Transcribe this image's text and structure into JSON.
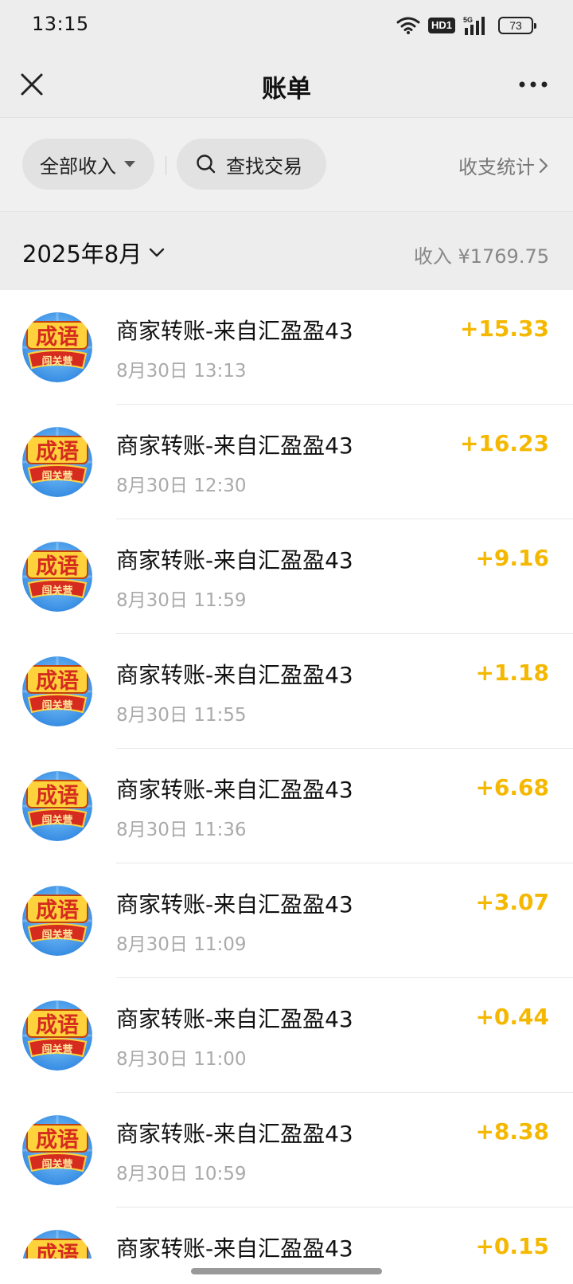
{
  "status_bar": {
    "time": "13:15",
    "hd_label": "HD1",
    "network_label": "5G",
    "battery": "73"
  },
  "nav": {
    "title": "账单",
    "close_icon": "close-icon",
    "more_icon": "more-icon"
  },
  "filters": {
    "income_filter_label": "全部收入",
    "search_label": "查找交易",
    "stats_label": "收支统计"
  },
  "month_header": {
    "month_label": "2025年8月",
    "income_total": "收入 ¥1769.75"
  },
  "colors": {
    "amount": "#f5b800",
    "background_header": "#ededed"
  },
  "transactions": [
    {
      "title": "商家转账-来自汇盈盈43",
      "time": "8月30日 13:13",
      "amount": "+15.33"
    },
    {
      "title": "商家转账-来自汇盈盈43",
      "time": "8月30日 12:30",
      "amount": "+16.23"
    },
    {
      "title": "商家转账-来自汇盈盈43",
      "time": "8月30日 11:59",
      "amount": "+9.16"
    },
    {
      "title": "商家转账-来自汇盈盈43",
      "time": "8月30日 11:55",
      "amount": "+1.18"
    },
    {
      "title": "商家转账-来自汇盈盈43",
      "time": "8月30日 11:36",
      "amount": "+6.68"
    },
    {
      "title": "商家转账-来自汇盈盈43",
      "time": "8月30日 11:09",
      "amount": "+3.07"
    },
    {
      "title": "商家转账-来自汇盈盈43",
      "time": "8月30日 11:00",
      "amount": "+0.44"
    },
    {
      "title": "商家转账-来自汇盈盈43",
      "time": "8月30日 10:59",
      "amount": "+8.38"
    },
    {
      "title": "商家转账-来自汇盈盈43",
      "time": "",
      "amount": "+0.15"
    }
  ]
}
